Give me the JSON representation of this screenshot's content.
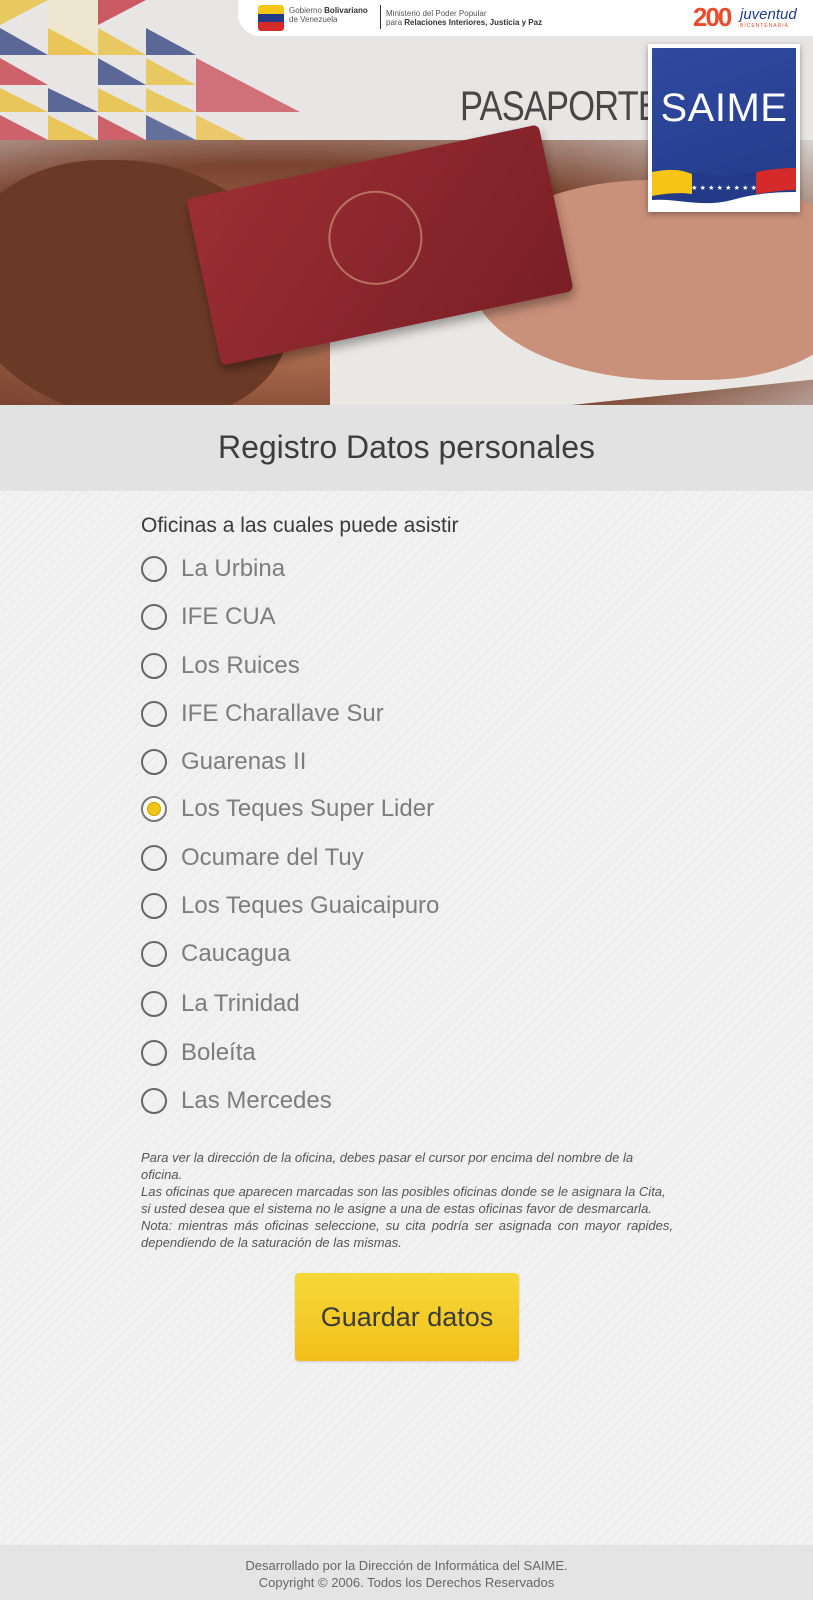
{
  "header": {
    "gov_line1_prefix": "Gobierno",
    "gov_line1_bold": "Bolivariano",
    "gov_line2": "de Venezuela",
    "ministry_line1": "Ministerio del Poder Popular",
    "ministry_line2_prefix": "para",
    "ministry_line2_bold": "Relaciones Interiores, Justicia y Paz",
    "juventud_number": "200",
    "juventud_word": "juventud",
    "juventud_sub": "BICENTENARIA",
    "pasaporte": "PASAPORTE",
    "saime": "SAIME"
  },
  "page": {
    "title": "Registro Datos personales"
  },
  "form": {
    "section_label": "Oficinas a las cuales puede asistir",
    "offices": [
      {
        "label": "La Urbina",
        "checked": false
      },
      {
        "label": "IFE CUA",
        "checked": false
      },
      {
        "label": "Los Ruices",
        "checked": false
      },
      {
        "label": "IFE Charallave Sur",
        "checked": false
      },
      {
        "label": "Guarenas II",
        "checked": false
      },
      {
        "label": "Los Teques Super Lider",
        "checked": true
      },
      {
        "label": "Ocumare del Tuy",
        "checked": false
      },
      {
        "label": "Los Teques Guaicaipuro",
        "checked": false
      },
      {
        "label": "Caucagua",
        "checked": false
      },
      {
        "label": "La Trinidad",
        "checked": false
      },
      {
        "label": "Boleíta",
        "checked": false
      },
      {
        "label": "Las Mercedes",
        "checked": false
      }
    ],
    "note_lines": [
      "Para ver la dirección de la oficina, debes pasar el cursor por encima del nombre de la oficina.",
      "Las oficinas que aparecen  marcadas son las posibles oficinas donde se le asignara la Cita,",
      "si usted desea que el sistema no le asigne a una de estas oficinas favor de desmarcarla.",
      "Nota: mientras más oficinas seleccione, su cita podría ser asignada con mayor rapides,",
      "dependiendo de la saturación de las mismas."
    ],
    "save_label": "Guardar datos"
  },
  "footer": {
    "line1": "Desarrollado por la Dirección de Informática del SAIME.",
    "line2": "Copyright © 2006. Todos los Derechos Reservados"
  },
  "colors": {
    "accent_yellow": "#f2c61f",
    "saime_blue": "#2b449a",
    "flag_yellow": "#f6c515",
    "flag_blue": "#233a88",
    "flag_red": "#d42a2a"
  }
}
